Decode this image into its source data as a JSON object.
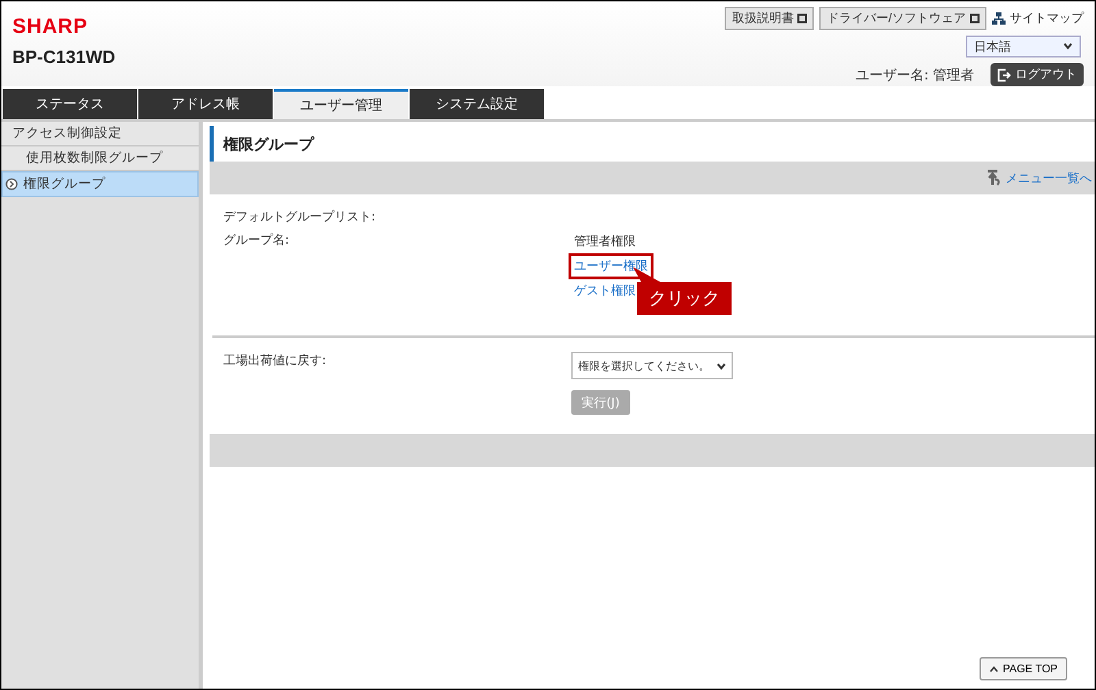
{
  "header": {
    "logo": "SHARP",
    "model": "BP-C131WD",
    "links": [
      {
        "label": "取扱説明書",
        "kind": "external"
      },
      {
        "label": "ドライバー/ソフトウェア",
        "kind": "external"
      },
      {
        "label": "サイトマップ",
        "kind": "sitemap"
      }
    ],
    "language": {
      "value": "日本語"
    },
    "user_label": "ユーザー名: 管理者",
    "logout": "ログアウト"
  },
  "tabs": [
    {
      "label": "ステータス",
      "selected": false
    },
    {
      "label": "アドレス帳",
      "selected": false
    },
    {
      "label": "ユーザー管理",
      "selected": true
    },
    {
      "label": "システム設定",
      "selected": false
    }
  ],
  "sidebar": {
    "items": [
      {
        "label": "アクセス制御設定",
        "selected": false,
        "children": [
          {
            "label": "使用枚数制限グループ",
            "selected": false
          },
          {
            "label": "権限グループ",
            "selected": true
          }
        ]
      }
    ]
  },
  "main": {
    "title": "権限グループ",
    "menu_link": "メニュー一覧へ",
    "group_list_label": "デフォルトグループリスト:",
    "group_name_label": "グループ名:",
    "groups": [
      {
        "label": "管理者権限",
        "kind": "text",
        "highlighted": false
      },
      {
        "label": "ユーザー権限",
        "kind": "link",
        "highlighted": true
      },
      {
        "label": "ゲスト権限",
        "kind": "link",
        "highlighted": false
      }
    ],
    "reset_label": "工場出荷値に戻す:",
    "reset_select": {
      "value": "権限を選択してください。"
    },
    "execute_button": {
      "label": "実行(J)",
      "disabled": true
    },
    "page_top": "PAGE TOP"
  },
  "annotation": {
    "text": "クリック"
  }
}
